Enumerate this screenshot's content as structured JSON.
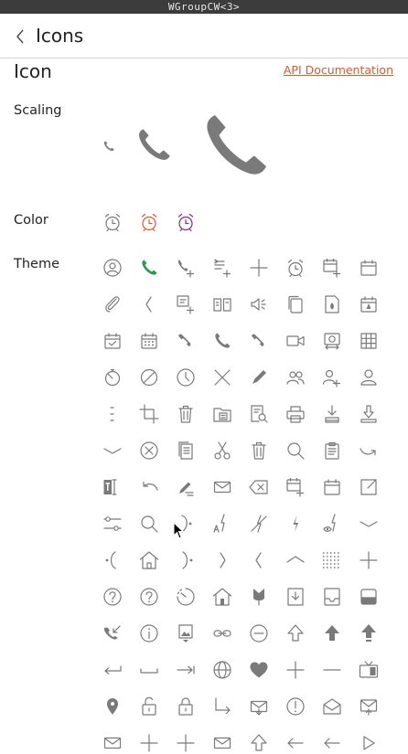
{
  "window": {
    "title": "WGroupCW<3>"
  },
  "header": {
    "title": "Icons"
  },
  "section": {
    "title": "Icon",
    "api_link": "API Documentation"
  },
  "rows": {
    "scaling": "Scaling",
    "color": "Color",
    "theme": "Theme"
  },
  "colors": {
    "icon_gray": "#7a7a7a",
    "green": "#1fa04a",
    "orange": "#e5562b",
    "purple": "#7a2d8c",
    "link": "#e5562b"
  },
  "scaling_icons": [
    "phone-icon",
    "phone-icon",
    "phone-icon"
  ],
  "color_icons": [
    "alarm-gray-icon",
    "alarm-orange-icon",
    "alarm-purple-icon"
  ],
  "theme_icons": [
    [
      "contact-icon",
      "phone-green-icon",
      "add-call-icon",
      "add-playlist-icon",
      "plus-icon",
      "alarm-icon",
      "add-calendar-icon",
      "calendar-icon"
    ],
    [
      "attachment-icon",
      "chevron-left-icon",
      "add-memo-icon",
      "book-icon",
      "speaker-icon",
      "copy-icon",
      "burn-document-icon",
      "calendar-tree-icon"
    ],
    [
      "calendar-check-icon",
      "calendar-grid-icon",
      "phone-end-icon",
      "phone-icon",
      "phone-end-icon",
      "video-call-icon",
      "camera-switch-icon",
      "grid-icon"
    ],
    [
      "timer-icon",
      "block-icon",
      "clock-icon",
      "close-icon",
      "pencil-icon",
      "group-icon",
      "add-person-icon",
      "person-icon"
    ],
    [
      "more-vertical-icon",
      "crop-icon",
      "delete-icon",
      "folder-doc-icon",
      "search-doc-icon",
      "print-icon",
      "download-doc-icon",
      "download-icon"
    ],
    [
      "chevron-down-icon",
      "close-circle-icon",
      "documents-icon",
      "scissors-icon",
      "delete-icon",
      "search-icon",
      "clipboard-icon",
      "redo-icon"
    ],
    [
      "text-field-icon",
      "undo-icon",
      "edit-note-icon",
      "mail-icon",
      "backspace-icon",
      "add-calendar-icon",
      "calendar-icon",
      "share-icon"
    ],
    [
      "settings-slider-icon",
      "search-icon",
      "forward-icon",
      "auto-flash-icon",
      "flash-off-icon",
      "flash-icon",
      "red-eye-flash-icon",
      "chevron-down-icon"
    ],
    [
      "back-dot-icon",
      "home-icon",
      "forward-dot-icon",
      "chevron-right-icon",
      "chevron-left-icon",
      "chevron-up-icon",
      "dot-grid-icon",
      "plus-icon"
    ],
    [
      "help-icon",
      "help-icon",
      "timer-dashed-icon",
      "home-door-icon",
      "tulip-icon",
      "download-box-icon",
      "inbox-icon",
      "tray-icon"
    ],
    [
      "incoming-call-icon",
      "info-icon",
      "image-frame-icon",
      "link-icon",
      "minus-circle-icon",
      "arrow-up-outline-icon",
      "arrow-up-filled-icon",
      "arrow-up-bar-icon"
    ],
    [
      "enter-icon",
      "space-icon",
      "tab-icon",
      "globe-icon",
      "heart-icon",
      "plus-icon",
      "minus-icon",
      "tv-icon"
    ],
    [
      "location-icon",
      "unlock-icon",
      "lock-icon",
      "down-right-arrow-icon",
      "mail-out-icon",
      "error-icon",
      "open-mail-icon",
      "mail-in-icon"
    ],
    [
      "mail-icon",
      "plus-icon",
      "plus-icon",
      "mail-icon",
      "arrow-up-outline-icon",
      "left-arrow-icon",
      "left-arrow-icon",
      "play-icon"
    ]
  ]
}
